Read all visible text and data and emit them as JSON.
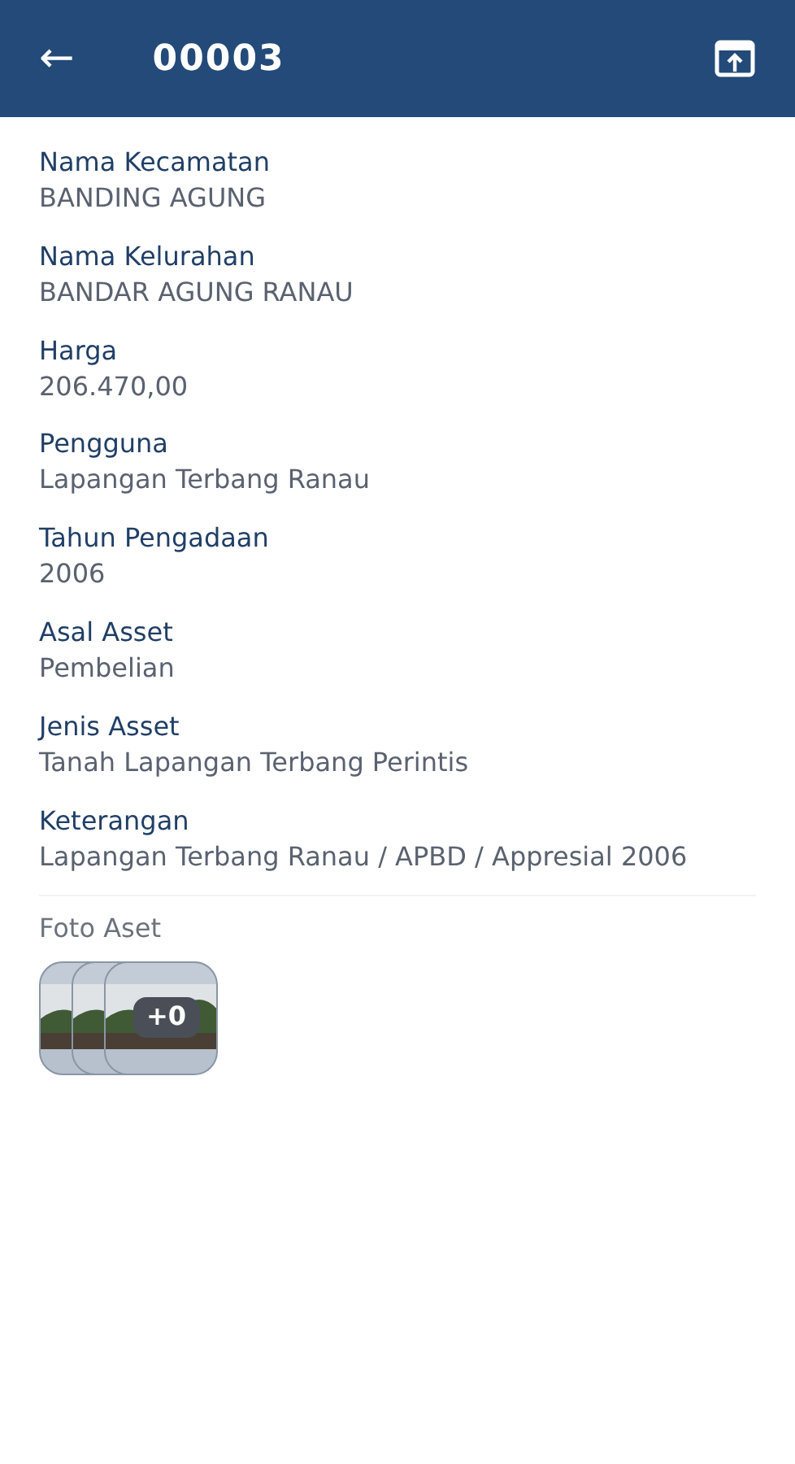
{
  "header": {
    "back": "←",
    "title": "00003"
  },
  "fields": [
    {
      "label": "Nama Kecamatan",
      "value": "BANDING AGUNG"
    },
    {
      "label": "Nama Kelurahan",
      "value": "BANDAR AGUNG RANAU"
    },
    {
      "label": "Harga",
      "value": "206.470,00"
    },
    {
      "label": "Pengguna",
      "value": "Lapangan Terbang Ranau"
    },
    {
      "label": "Tahun Pengadaan",
      "value": "2006"
    },
    {
      "label": "Asal Asset",
      "value": "Pembelian"
    },
    {
      "label": "Jenis Asset",
      "value": "Tanah Lapangan Terbang Perintis"
    },
    {
      "label": "Keterangan",
      "value": "Lapangan Terbang Ranau / APBD / Appresial 2006"
    }
  ],
  "photos": {
    "label": "Foto Aset",
    "more": "+0"
  }
}
